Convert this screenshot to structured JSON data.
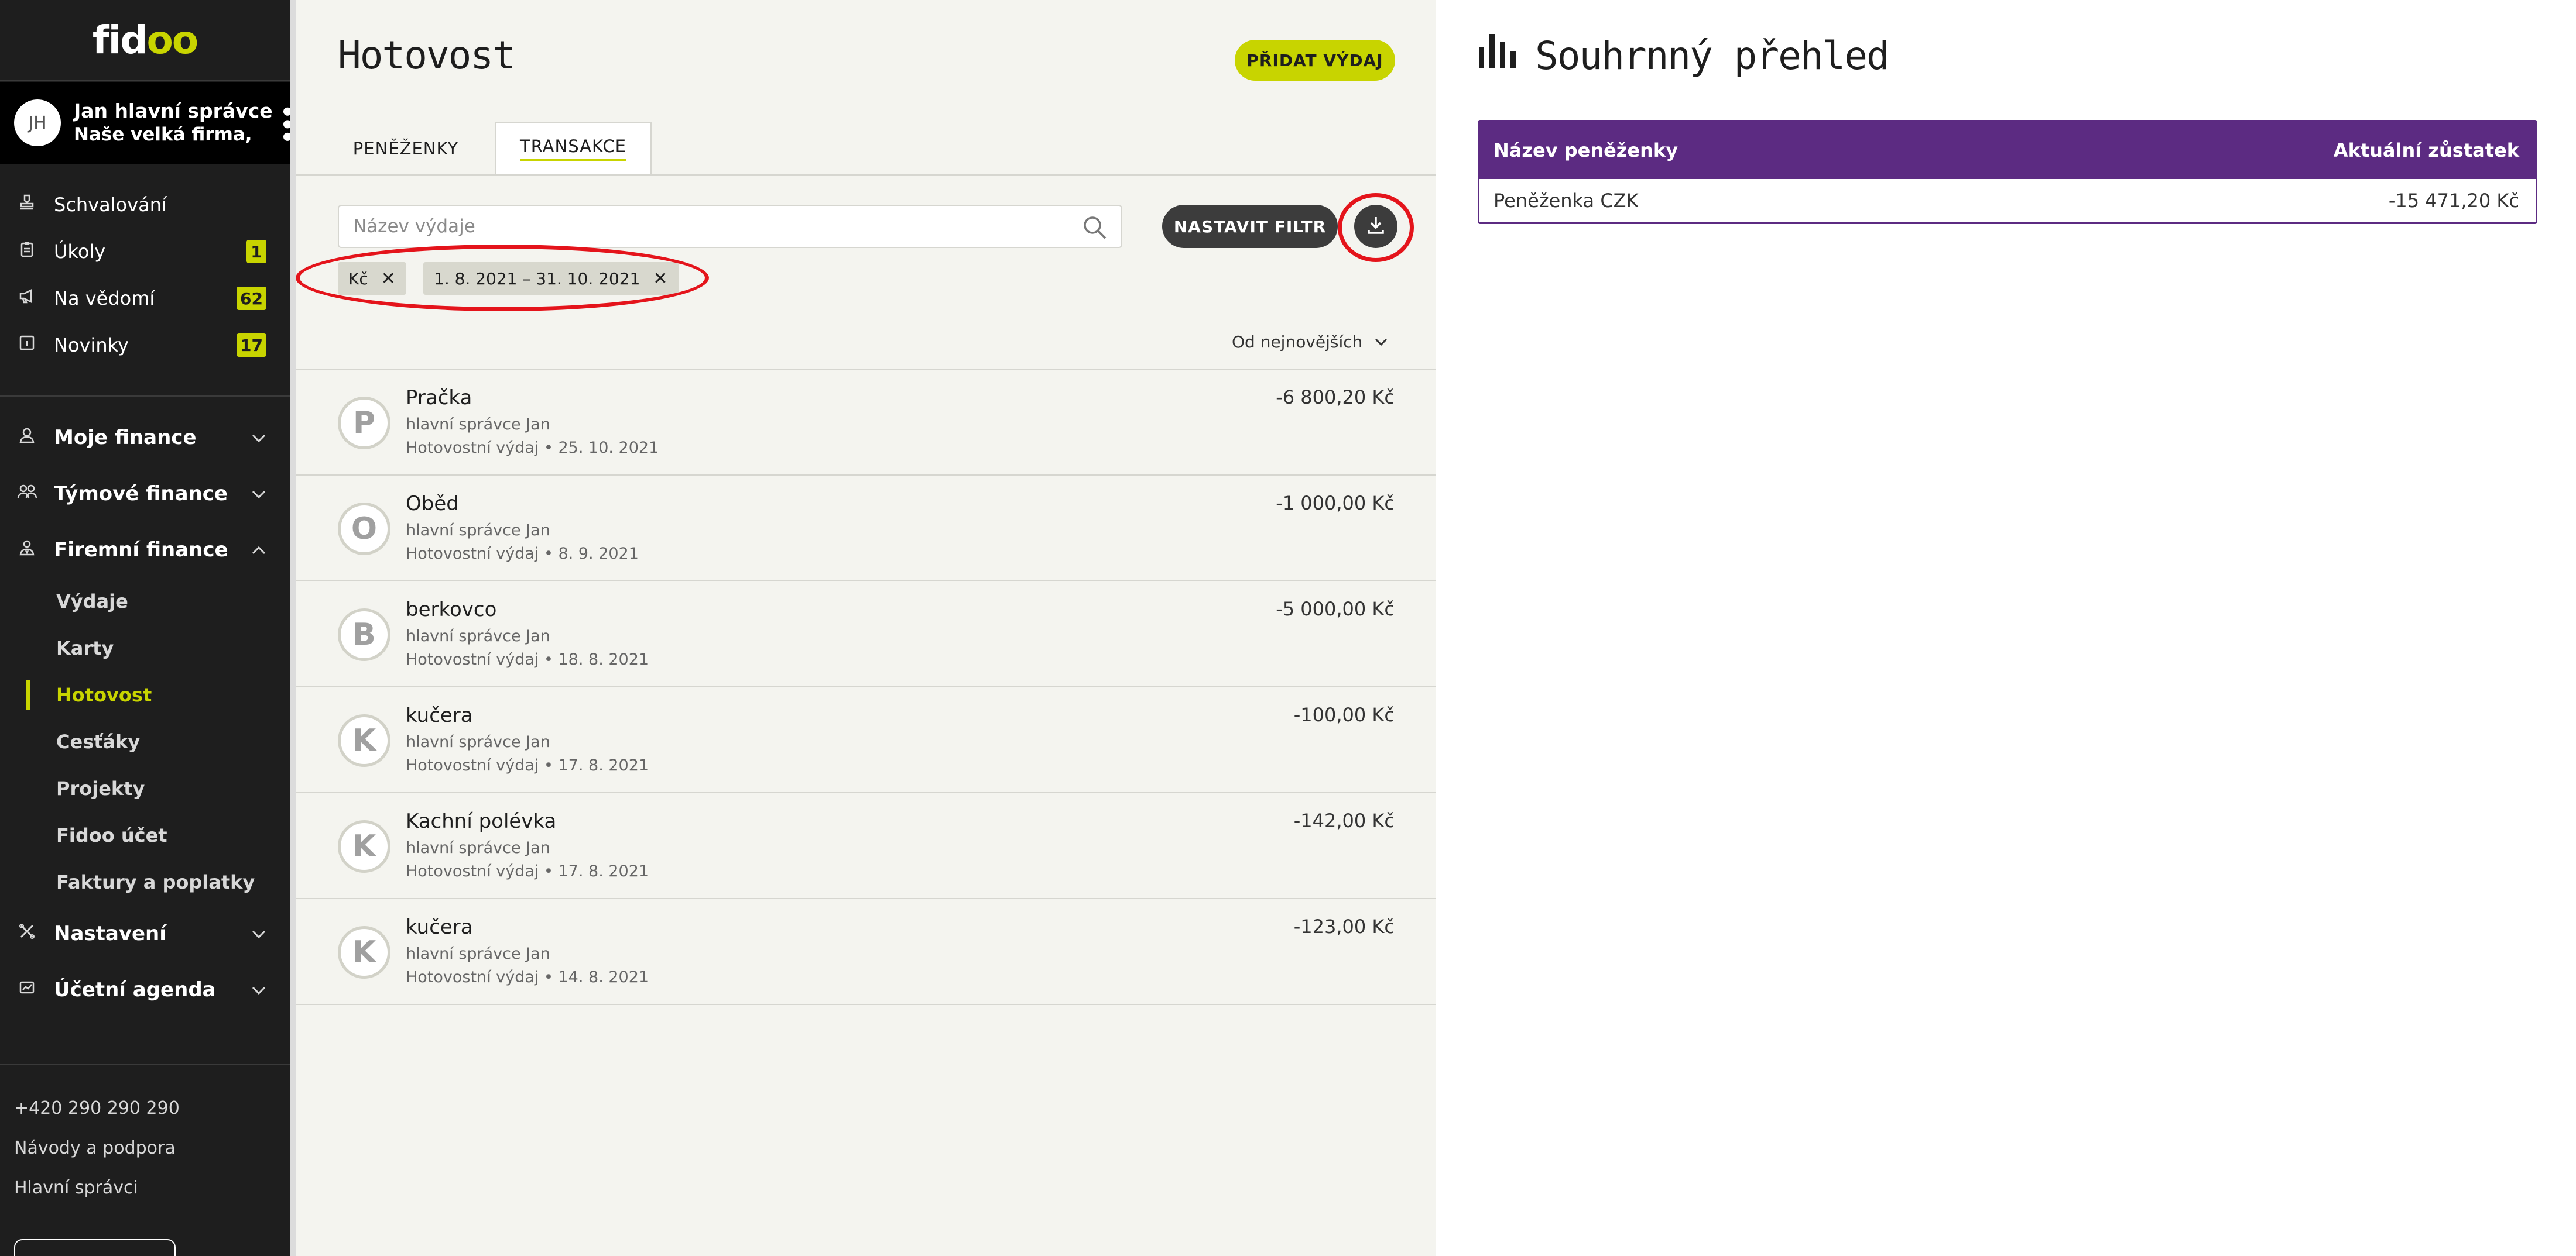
{
  "logo": {
    "part1": "fid",
    "part2": "o",
    "part3": "o"
  },
  "user": {
    "initials": "JH",
    "name": "Jan hlavní správce",
    "company": "Naše velká firma, ..."
  },
  "nav_top": [
    {
      "label": "Schvalování",
      "icon": "stamp-icon",
      "badge": ""
    },
    {
      "label": "Úkoly",
      "icon": "clipboard-icon",
      "badge": "1"
    },
    {
      "label": "Na vědomí",
      "icon": "megaphone-icon",
      "badge": "62"
    },
    {
      "label": "Novinky",
      "icon": "info-icon",
      "badge": "17"
    }
  ],
  "nav_main": {
    "moje_finance": "Moje finance",
    "tymove_finance": "Týmové finance",
    "firemni_finance": "Firemní finance",
    "sub": [
      "Výdaje",
      "Karty",
      "Hotovost",
      "Cesťáky",
      "Projekty",
      "Fidoo účet",
      "Faktury a poplatky"
    ],
    "active_sub": "Hotovost",
    "nastaveni": "Nastavení",
    "ucetni_agenda": "Účetní agenda"
  },
  "footer": {
    "phone": "+420 290 290 290",
    "help": "Návody a podpora",
    "admins": "Hlavní správci"
  },
  "main": {
    "title": "Hotovost",
    "add_button": "PŘIDAT VÝDAJ",
    "tabs": [
      "PENĚŽENKY",
      "TRANSAKCE"
    ],
    "active_tab": "TRANSAKCE",
    "search_placeholder": "Název výdaje",
    "filter_button": "NASTAVIT FILTR",
    "chips": [
      "Kč",
      "1. 8. 2021 – 31. 10. 2021"
    ],
    "sort_label": "Od nejnovějších",
    "transactions": [
      {
        "initial": "P",
        "title": "Pračka",
        "user": "hlavní správce Jan",
        "meta": "Hotovostní výdaj • 25. 10. 2021",
        "amount": "-6 800,20 Kč"
      },
      {
        "initial": "O",
        "title": "Oběd",
        "user": "hlavní správce Jan",
        "meta": "Hotovostní výdaj • 8. 9. 2021",
        "amount": "-1 000,00 Kč"
      },
      {
        "initial": "B",
        "title": "berkovco",
        "user": "hlavní správce Jan",
        "meta": "Hotovostní výdaj • 18. 8. 2021",
        "amount": "-5 000,00 Kč"
      },
      {
        "initial": "K",
        "title": "kučera",
        "user": "hlavní správce Jan",
        "meta": "Hotovostní výdaj • 17. 8. 2021",
        "amount": "-100,00 Kč"
      },
      {
        "initial": "K",
        "title": "Kachní polévka",
        "user": "hlavní správce Jan",
        "meta": "Hotovostní výdaj • 17. 8. 2021",
        "amount": "-142,00 Kč"
      },
      {
        "initial": "K",
        "title": "kučera",
        "user": "hlavní správce Jan",
        "meta": "Hotovostní výdaj • 14. 8. 2021",
        "amount": "-123,00 Kč"
      }
    ]
  },
  "summary": {
    "title": "Souhrnný přehled",
    "col_name": "Název peněženky",
    "col_balance": "Aktuální zůstatek",
    "rows": [
      {
        "name": "Peněženka CZK",
        "balance": "-15 471,20 Kč"
      }
    ]
  },
  "colors": {
    "accent": "#c8d400",
    "sidebar": "#1e1e1e",
    "summary_header": "#5c2b82",
    "annotation_red": "#e4141b"
  }
}
